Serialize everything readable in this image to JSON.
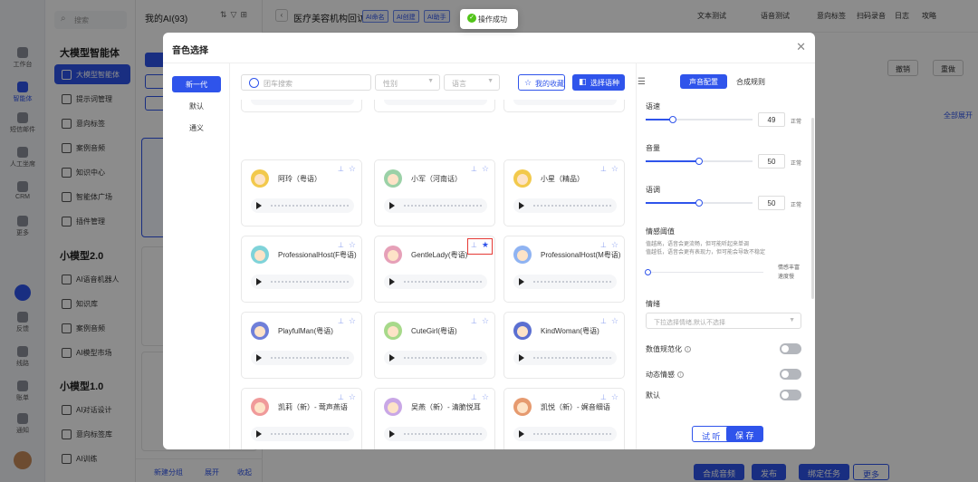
{
  "rail": {
    "items": [
      {
        "label": "工作台"
      },
      {
        "label": "智能体"
      },
      {
        "label": "短信邮件"
      },
      {
        "label": "人工坐席"
      },
      {
        "label": "CRM"
      },
      {
        "label": "更多"
      },
      {
        "label": "反馈"
      },
      {
        "label": "线路"
      },
      {
        "label": "账单"
      },
      {
        "label": "通知"
      }
    ]
  },
  "nav": {
    "search_placeholder": "搜索",
    "groups": [
      {
        "title": "大模型智能体"
      },
      {
        "title": "小模型2.0"
      },
      {
        "title": "小模型1.0"
      }
    ],
    "items": [
      {
        "label": "大模型智能体"
      },
      {
        "label": "提示词管理"
      },
      {
        "label": "意向标签"
      },
      {
        "label": "案例音频"
      },
      {
        "label": "知识中心"
      },
      {
        "label": "智能体广场"
      },
      {
        "label": "插件管理"
      },
      {
        "label": "AI语音机器人"
      },
      {
        "label": "知识库"
      },
      {
        "label": "案例音频"
      },
      {
        "label": "AI模型市场"
      },
      {
        "label": "AI对话设计"
      },
      {
        "label": "意向标签库"
      },
      {
        "label": "AI训练"
      }
    ]
  },
  "list": {
    "title": "我的AI(93)",
    "footer": {
      "new_group": "新建分组",
      "expand": "展开",
      "collapse": "收起"
    }
  },
  "main": {
    "title": "医疗美容机构回访",
    "tags": [
      "AI命名",
      "AI创建",
      "AI助手"
    ],
    "top_links": [
      "文本测试",
      "语音测试",
      "意向标签",
      "扫码录音",
      "日志",
      "攻略"
    ],
    "undo": "撤销",
    "redo": "重做",
    "expand_all": "全部展开",
    "bottom_buttons": [
      "合成音频",
      "发布",
      "绑定任务",
      "更多"
    ]
  },
  "toast": {
    "text": "操作成功"
  },
  "modal": {
    "title": "音色选择",
    "generations": [
      {
        "label": "新一代"
      },
      {
        "label": "默认"
      },
      {
        "label": "通义"
      }
    ],
    "search": {
      "placeholder": "团车搜索",
      "gender_placeholder": "性别",
      "language_placeholder": "语言",
      "favorites_label": "我的收藏",
      "select_language_label": "选择语种"
    },
    "voices": [
      {
        "name": "阿玲（粤语）",
        "avatar_color": "#f2c94c",
        "favorited": false
      },
      {
        "name": "小军（河南话）",
        "avatar_color": "#9bd1a7",
        "favorited": false
      },
      {
        "name": "小星（精品）",
        "avatar_color": "#f2c94c",
        "favorited": false
      },
      {
        "name": "ProfessionalHost(F粤语)",
        "avatar_color": "#7fd3d9",
        "favorited": false
      },
      {
        "name": "GentleLady(粤语)",
        "avatar_color": "#e6a0b8",
        "favorited": true
      },
      {
        "name": "ProfessionalHost(M粤语)",
        "avatar_color": "#8fb3f2",
        "favorited": false
      },
      {
        "name": "PlayfulMan(粤语)",
        "avatar_color": "#6f7fd9",
        "favorited": false
      },
      {
        "name": "CuteGirl(粤语)",
        "avatar_color": "#a7d98a",
        "favorited": false
      },
      {
        "name": "KindWoman(粤语)",
        "avatar_color": "#5b6fd1",
        "favorited": false
      },
      {
        "name": "凯莉（新）- 莺声燕语",
        "avatar_color": "#f09a9a",
        "favorited": false
      },
      {
        "name": "吴燕（新）- 清脆悦耳",
        "avatar_color": "#c9a7e6",
        "favorited": false
      },
      {
        "name": "凯悦（新）- 娓音细语",
        "avatar_color": "#e69a6f",
        "favorited": false
      }
    ],
    "config": {
      "tab_voice": "声音配置",
      "tab_rules": "合成规则",
      "speed": {
        "label": "语速",
        "value": "49",
        "unit": "正常",
        "level": 0.25
      },
      "volume": {
        "label": "音量",
        "value": "50",
        "unit": "正常",
        "level": 0.5
      },
      "pitch": {
        "label": "语调",
        "value": "50",
        "unit": "正常",
        "level": 0.5
      },
      "emotion_threshold": {
        "label": "情感阈值",
        "note1": "值越高，语音会更流畅，但可能听起来单调",
        "note2": "值越低，语音会更有表现力，但可能会导致不稳定",
        "end_label1": "情感丰富",
        "end_label2": "速度慢"
      },
      "emotion": {
        "label": "情绪",
        "placeholder": "下拉选择情绪,默认不选择"
      },
      "numeric_normalize": {
        "label": "数值规范化"
      },
      "dynamic_emotion": {
        "label": "动态情感"
      },
      "default": {
        "label": "默认"
      },
      "listen_button": "试 听",
      "save_button": "保 存"
    }
  }
}
